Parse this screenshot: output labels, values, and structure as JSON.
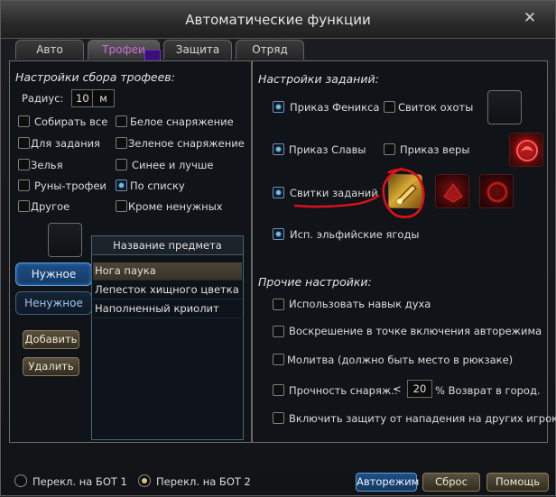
{
  "window": {
    "title": "Автоматические функции",
    "close_glyph": "✕"
  },
  "tabs": [
    {
      "label": "Авто"
    },
    {
      "label": "Трофеи",
      "active": true
    },
    {
      "label": "Защита"
    },
    {
      "label": "Отряд"
    }
  ],
  "loot": {
    "header": "Настройки сбора трофеев:",
    "radius_label": "Радиус:",
    "radius_value": "10",
    "radius_unit": "м",
    "options": [
      {
        "label": "Собирать все",
        "checked": false
      },
      {
        "label": "Белое снаряжение",
        "checked": false
      },
      {
        "label": "Для задания",
        "checked": false
      },
      {
        "label": "Зеленое снаряжение",
        "checked": false
      },
      {
        "label": "Зелья",
        "checked": false
      },
      {
        "label": "Синее и лучше",
        "checked": false
      },
      {
        "label": "Руны-трофеи",
        "checked": false
      },
      {
        "label": "По списку",
        "checked": true
      },
      {
        "label": "Другое",
        "checked": false
      },
      {
        "label": "Кроме ненужных",
        "checked": false
      }
    ],
    "needed_btn": "Нужное",
    "unneeded_btn": "Ненужное",
    "add_btn": "Добавить",
    "delete_btn": "Удалить",
    "list_header": "Название предмета",
    "items": [
      "Нога паука",
      "Лепесток хищного цветка",
      "Наполненный криолит"
    ]
  },
  "quests": {
    "header": "Настройки заданий:",
    "options": [
      {
        "label": "Приказ Феникса",
        "checked": true
      },
      {
        "label": "Свиток охоты",
        "checked": false
      },
      {
        "label": "Приказ Славы",
        "checked": true
      },
      {
        "label": "Приказ веры",
        "checked": false
      },
      {
        "label": "Свитки заданий",
        "checked": true
      },
      {
        "label": "Исп. эльфийские ягоды",
        "checked": true
      }
    ]
  },
  "other": {
    "header": "Прочие настройки:",
    "options": [
      {
        "label": "Использовать навык духа",
        "checked": false
      },
      {
        "label": "Воскрешение в точке включения авторежима",
        "checked": false
      },
      {
        "label": "Молитва (должно быть место в рюкзаке)",
        "checked": false
      },
      {
        "label": "Прочность снаряж.:",
        "checked": false
      },
      {
        "label": "Включить защиту от нападения на других игроков.",
        "checked": false
      }
    ],
    "durability_lt": "<",
    "durability_value": "20",
    "durability_suffix": "% Возврат в город."
  },
  "footer": {
    "bot1": "Перекл. на БОТ 1",
    "bot2": "Перекл. на БОТ 2",
    "bot2_selected": true,
    "auto_btn": "Авторежим",
    "reset_btn": "Сброс",
    "help_btn": "Помощь"
  },
  "colors": {
    "accent_blue": "#6cc0ff",
    "active_tab_text": "#d26bd8",
    "annotation_red": "#e0101a"
  },
  "icons": [
    "close-icon",
    "golden-scroll-icon",
    "phoenix-emblem-icon",
    "red-token-icon"
  ]
}
